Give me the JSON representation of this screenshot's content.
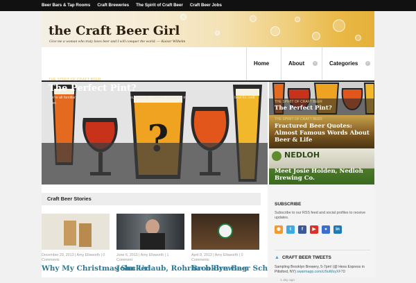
{
  "topnav": {
    "items": [
      "Beer Bars & Tap Rooms",
      "Craft Breweries",
      "The Spirit of Craft Beer",
      "Craft Beer Jobs"
    ]
  },
  "header": {
    "logo": "the Craft Beer Girl",
    "tagline": "Give me a woman who truly loves beer and I will conquer the world. — Kaiser Wilhelm"
  },
  "mainnav": {
    "items": [
      {
        "label": "Home",
        "has_dropdown": false
      },
      {
        "label": "About",
        "has_dropdown": true
      },
      {
        "label": "Categories",
        "has_dropdown": true
      }
    ]
  },
  "hero": {
    "category": "The Spirit of Craft Beer",
    "title": "The Perfect Pint?",
    "excerpt": "We're all familiar with the standard shaker pint glass, being the common choice for many beer drinkers, it's not the best for craft beer."
  },
  "side_features": [
    {
      "category": "The Spirit of Craft Beer",
      "title": "The Perfect Pint?"
    },
    {
      "category": "The Spirit of Craft Beer",
      "title": "Fractured Beer Quotes: Almost Famous Words About Beer & Life"
    },
    {
      "category": "",
      "title": "Meet Josie Holden, Nedloh Brewing Co.",
      "image_text": "NEDLOH"
    }
  ],
  "stories_section": {
    "title": "Craft Beer Stories",
    "stories": [
      {
        "meta": "December 29, 2013 | Amy Ellsworth | 0 Comments",
        "title": "Why My Christmas Sucked"
      },
      {
        "meta": "June 6, 2013 | Amy Ellsworth | 1 Comment",
        "title": "John Urlaub, Rohrbach Brewing"
      },
      {
        "meta": "April 8, 2013 | Amy Ellsworth | 0 Comments",
        "title": "Brooklyn Beer School"
      }
    ]
  },
  "subscribe": {
    "title": "SUBSCRIBE",
    "text": "Subscribe to our RSS feed and social profiles to receive updates.",
    "icons": [
      {
        "name": "rss-icon",
        "color": "#f29a2e",
        "glyph": "◉"
      },
      {
        "name": "twitter-icon",
        "color": "#40a9e0",
        "glyph": "t"
      },
      {
        "name": "facebook-icon",
        "color": "#3b5998",
        "glyph": "f"
      },
      {
        "name": "youtube-icon",
        "color": "#d8322a",
        "glyph": "▶"
      },
      {
        "name": "flickr-icon",
        "color": "#3a6fd0",
        "glyph": "●"
      },
      {
        "name": "linkedin-icon",
        "color": "#1f7bb6",
        "glyph": "in"
      }
    ]
  },
  "tweets": {
    "title": "CRAFT BEER TWEETS",
    "text": "Sampling Brooklyn Brewery, 5-7pm! (@ Hess Express in Pittsford, NY)",
    "link": "swarmapp.com/c/9uWoyXF7D",
    "time": "1 day ago"
  },
  "colors": {
    "accent_link": "#2b7a98",
    "topbar": "#111111",
    "hero_category": "#e3c87a"
  }
}
